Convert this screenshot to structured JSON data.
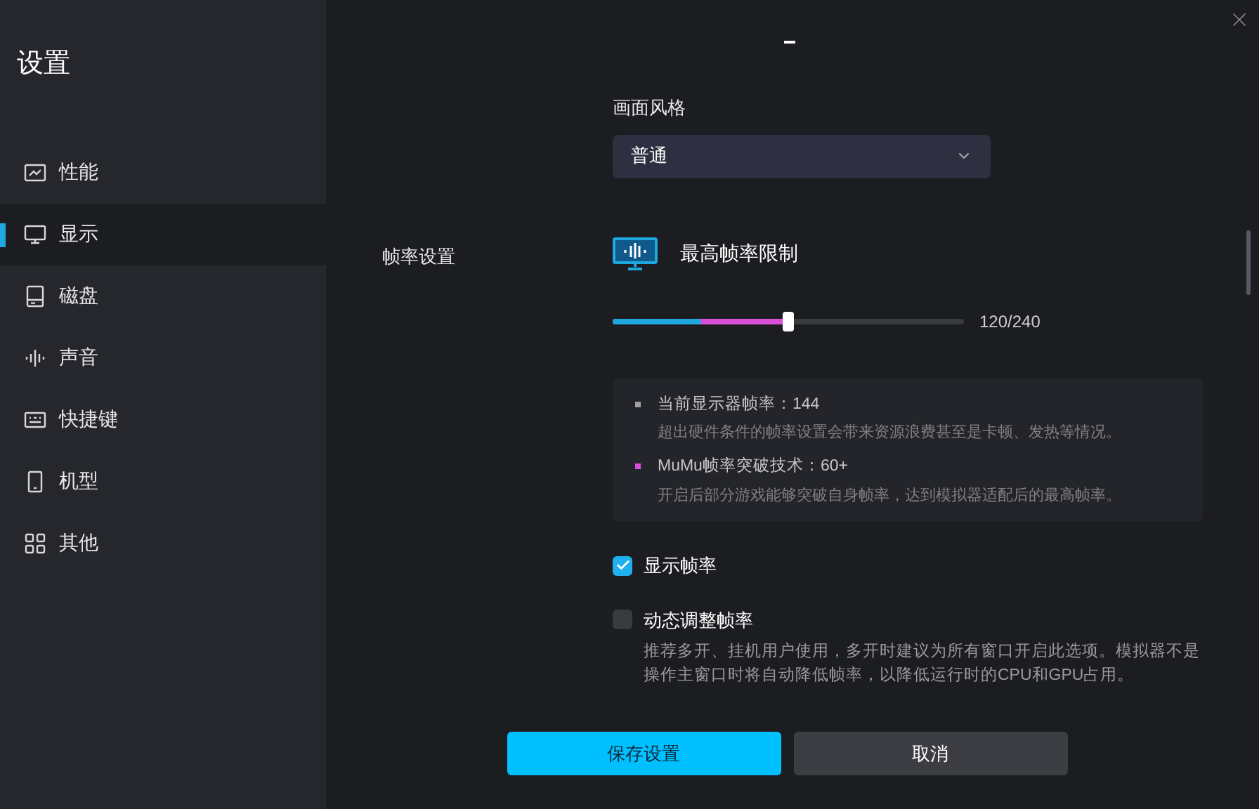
{
  "sidebar": {
    "title": "设置",
    "items": [
      {
        "label": "性能",
        "kind": "chart",
        "selected": false
      },
      {
        "label": "显示",
        "kind": "monitor",
        "selected": true
      },
      {
        "label": "磁盘",
        "kind": "disk",
        "selected": false
      },
      {
        "label": "声音",
        "kind": "sound",
        "selected": false
      },
      {
        "label": "快捷键",
        "kind": "keyboard",
        "selected": false
      },
      {
        "label": "机型",
        "kind": "phone",
        "selected": false
      },
      {
        "label": "其他",
        "kind": "grid",
        "selected": false
      }
    ]
  },
  "style": {
    "label": "画面风格",
    "value": "普通"
  },
  "frame": {
    "section_label": "帧率设置",
    "title": "最高帧率限制",
    "slider": {
      "level": 0.5,
      "base": {
        "level": 0.25
      },
      "reading": "120/240"
    },
    "notes": [
      {
        "title": "当前显示器帧率：144",
        "text": "超出硬件条件的帧率设置会带来资源浪费甚至是卡顿、发热等情况。",
        "color": "#a0a0a0"
      },
      {
        "title": "MuMu帧率突破技术：60+",
        "text": "开启后部分游戏能够突破自身帧率，达到模拟器适配后的最高帧率。",
        "color": "#d94fd8"
      }
    ],
    "options": [
      {
        "label": "显示帧率",
        "checked": true
      },
      {
        "label": "动态调整帧率",
        "checked": false,
        "text": "推荐多开、挂机用户使用，多开时建议为所有窗口开启此选项。模拟器不是操作主窗口时将自动降低帧率，以降低运行时的CPU和GPU占用。"
      }
    ]
  },
  "buttons": [
    {
      "label": "保存设置",
      "kind": "primary"
    },
    {
      "label": "取消",
      "kind": "secondary"
    }
  ]
}
